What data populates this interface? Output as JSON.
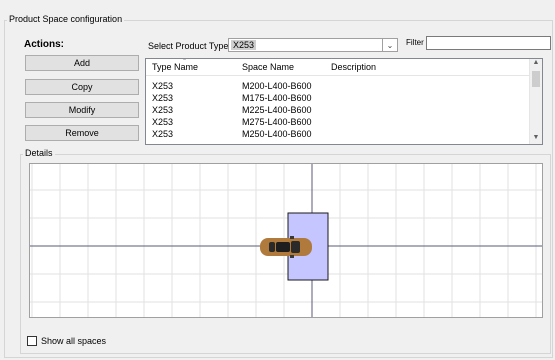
{
  "group_title": "Product Space configuration",
  "actions": {
    "title": "Actions:",
    "buttons": [
      "Add",
      "Copy",
      "Modify",
      "Remove"
    ]
  },
  "product_type": {
    "label": "Select Product Type",
    "value": "X253"
  },
  "filter": {
    "label": "Filter",
    "value": ""
  },
  "list": {
    "columns": [
      "Type Name",
      "Space Name",
      "Description"
    ],
    "rows": [
      {
        "type": "X253",
        "space": "M200-L400-B600",
        "description": ""
      },
      {
        "type": "X253",
        "space": "M175-L400-B600",
        "description": ""
      },
      {
        "type": "X253",
        "space": "M225-L400-B600",
        "description": ""
      },
      {
        "type": "X253",
        "space": "M275-L400-B600",
        "description": ""
      },
      {
        "type": "X253",
        "space": "M250-L400-B600",
        "description": ""
      }
    ]
  },
  "details": {
    "title": "Details",
    "colors": {
      "grid": "#e2e2e2",
      "axis": "#5a5a7a",
      "space_fill": "#c5c5ff",
      "car_body": "#b07a3c"
    }
  },
  "show_all_spaces": {
    "label": "Show all spaces",
    "checked": false
  }
}
